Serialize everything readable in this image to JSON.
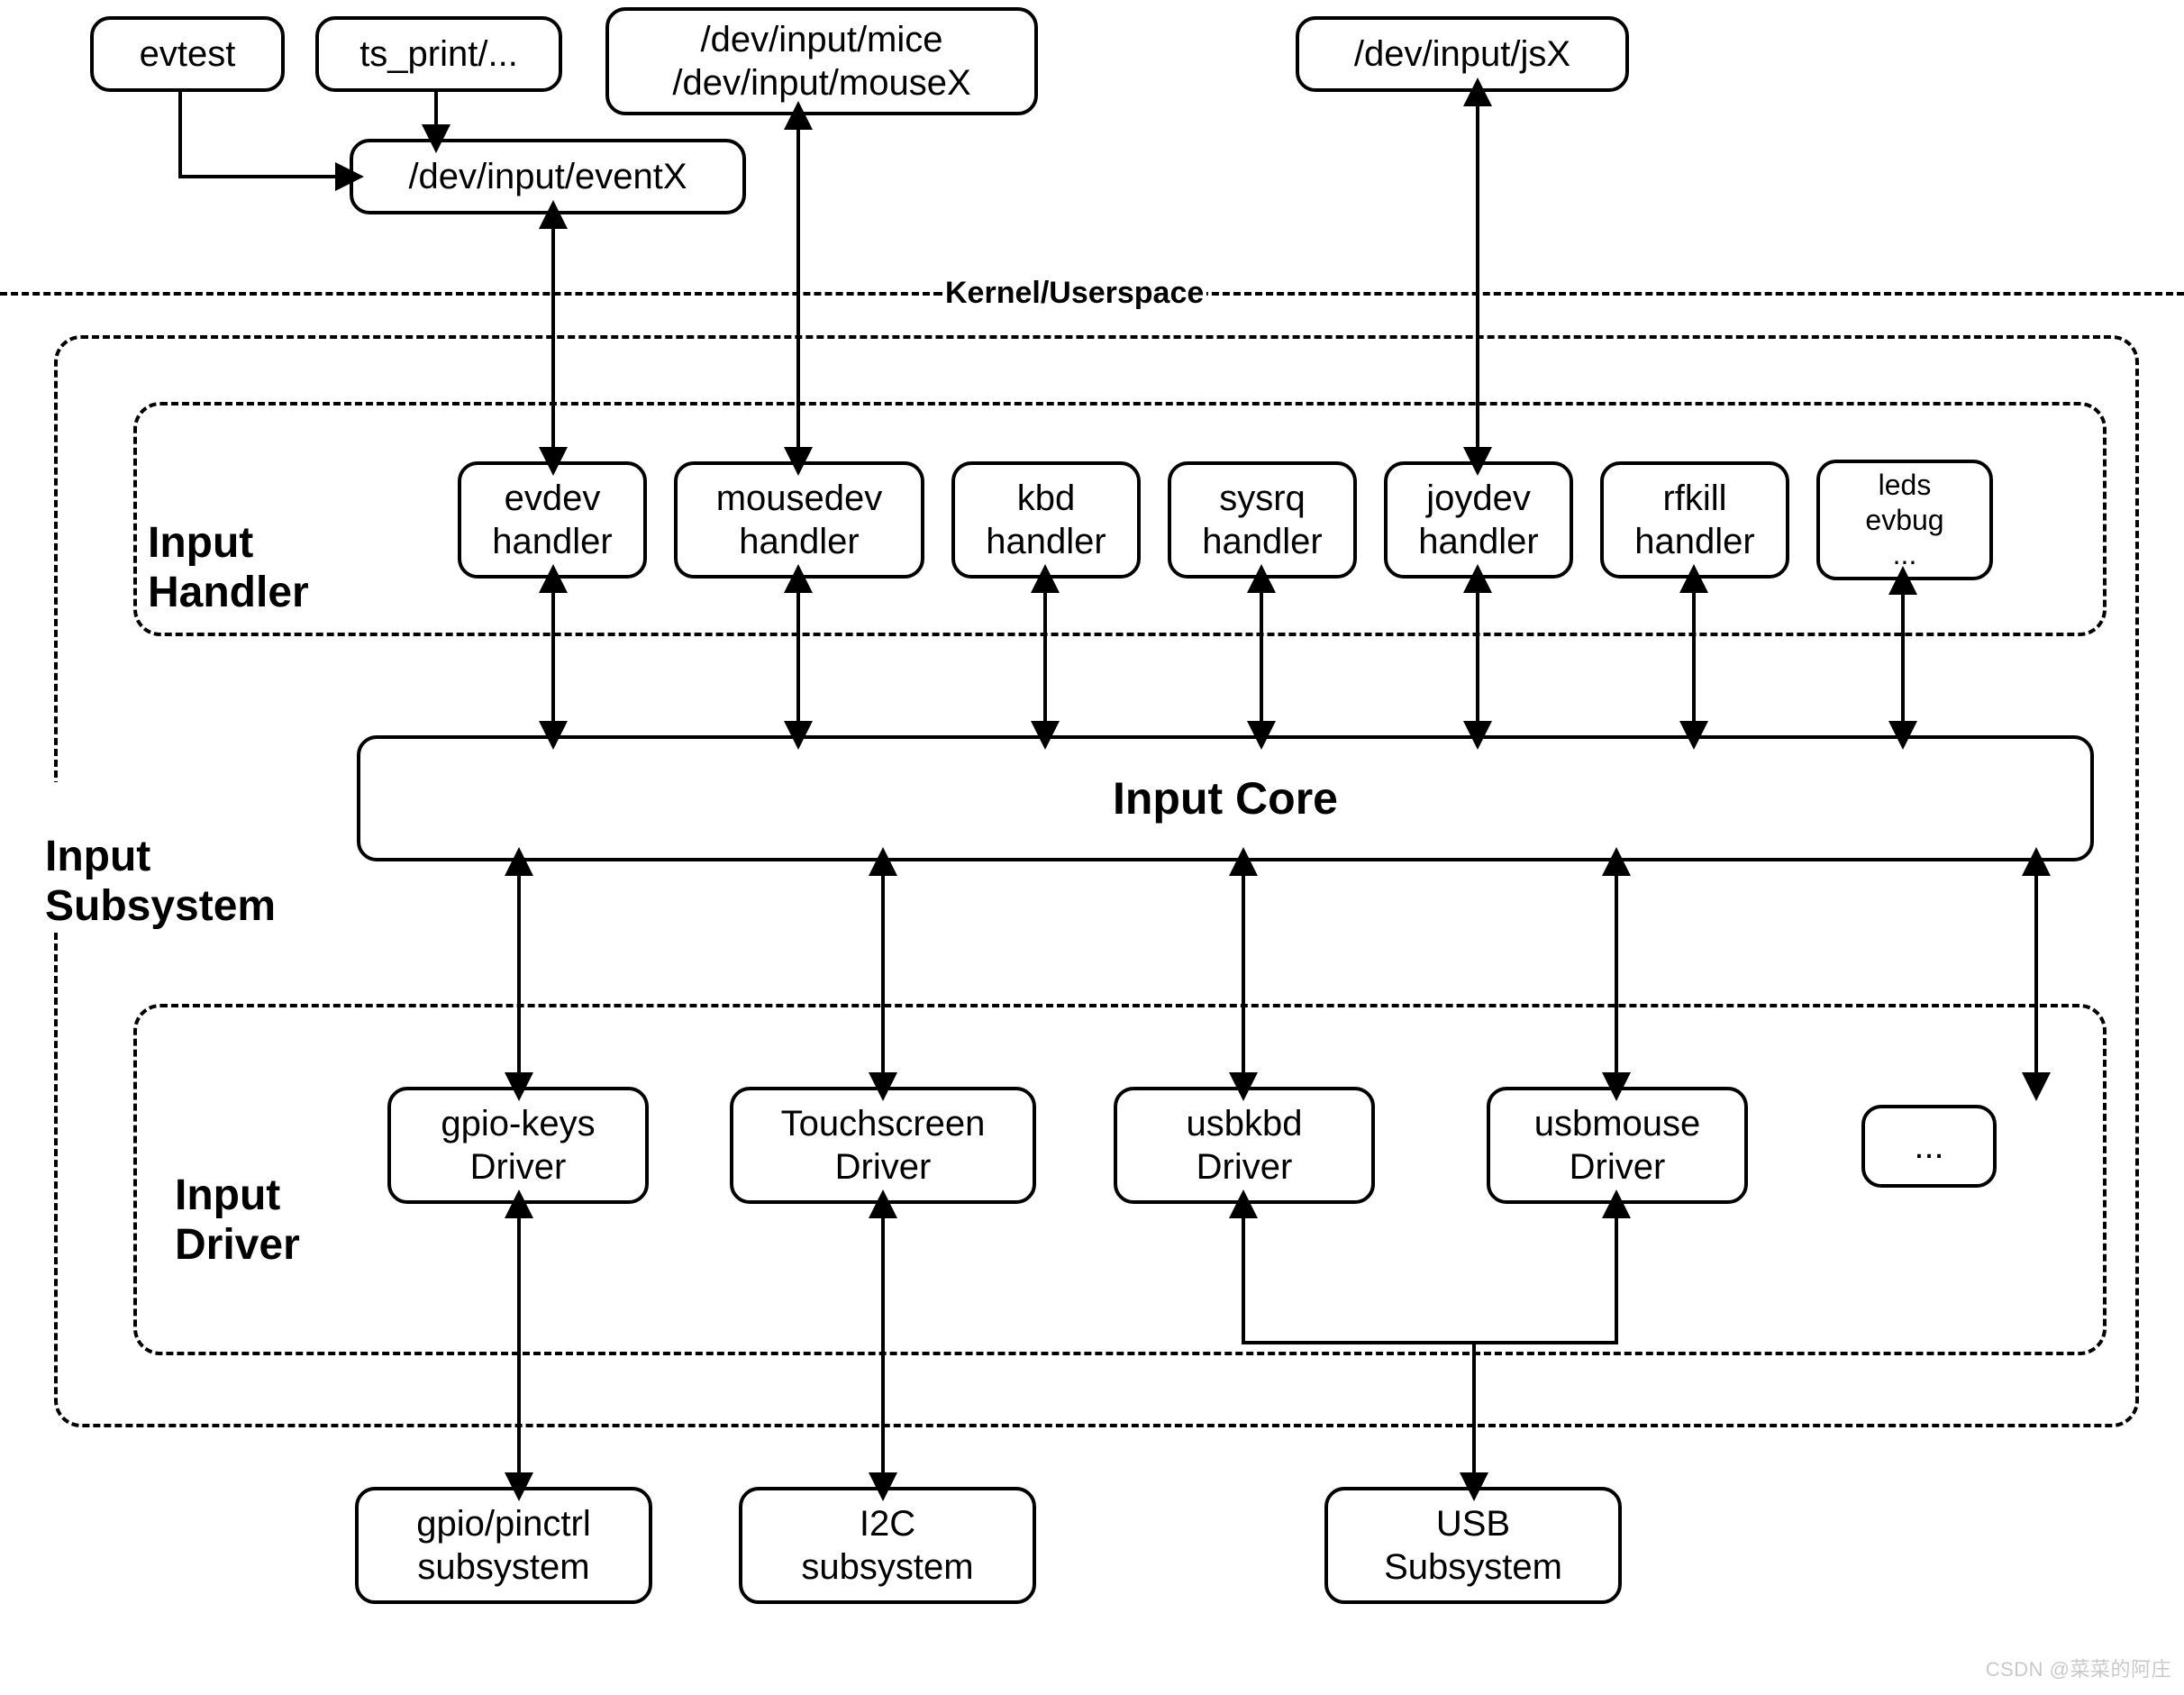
{
  "userspace": {
    "evtest": "evtest",
    "ts_print": "ts_print/...",
    "dev_eventx": "/dev/input/eventX",
    "dev_mice": "/dev/input/mice\n/dev/input/mouseX",
    "dev_jsx": "/dev/input/jsX"
  },
  "boundary": {
    "label": "Kernel/Userspace"
  },
  "subsystem": {
    "title": "Input\nSubsystem",
    "handler": {
      "title": "Input\nHandler",
      "items": {
        "evdev": "evdev\nhandler",
        "mousedev": "mousedev\nhandler",
        "kbd": "kbd\nhandler",
        "sysrq": "sysrq\nhandler",
        "joydev": "joydev\nhandler",
        "rfkill": "rfkill\nhandler",
        "misc": "leds\nevbug\n..."
      }
    },
    "core": "Input Core",
    "driver": {
      "title": "Input\nDriver",
      "items": {
        "gpiokeys": "gpio-keys\nDriver",
        "touchscreen": "Touchscreen\nDriver",
        "usbkbd": "usbkbd\nDriver",
        "usbmouse": "usbmouse\nDriver",
        "etc": "..."
      }
    }
  },
  "low_subsystems": {
    "gpio": "gpio/pinctrl\nsubsystem",
    "i2c": "I2C\nsubsystem",
    "usb": "USB\nSubsystem"
  },
  "watermark": "CSDN @菜菜的阿庄"
}
